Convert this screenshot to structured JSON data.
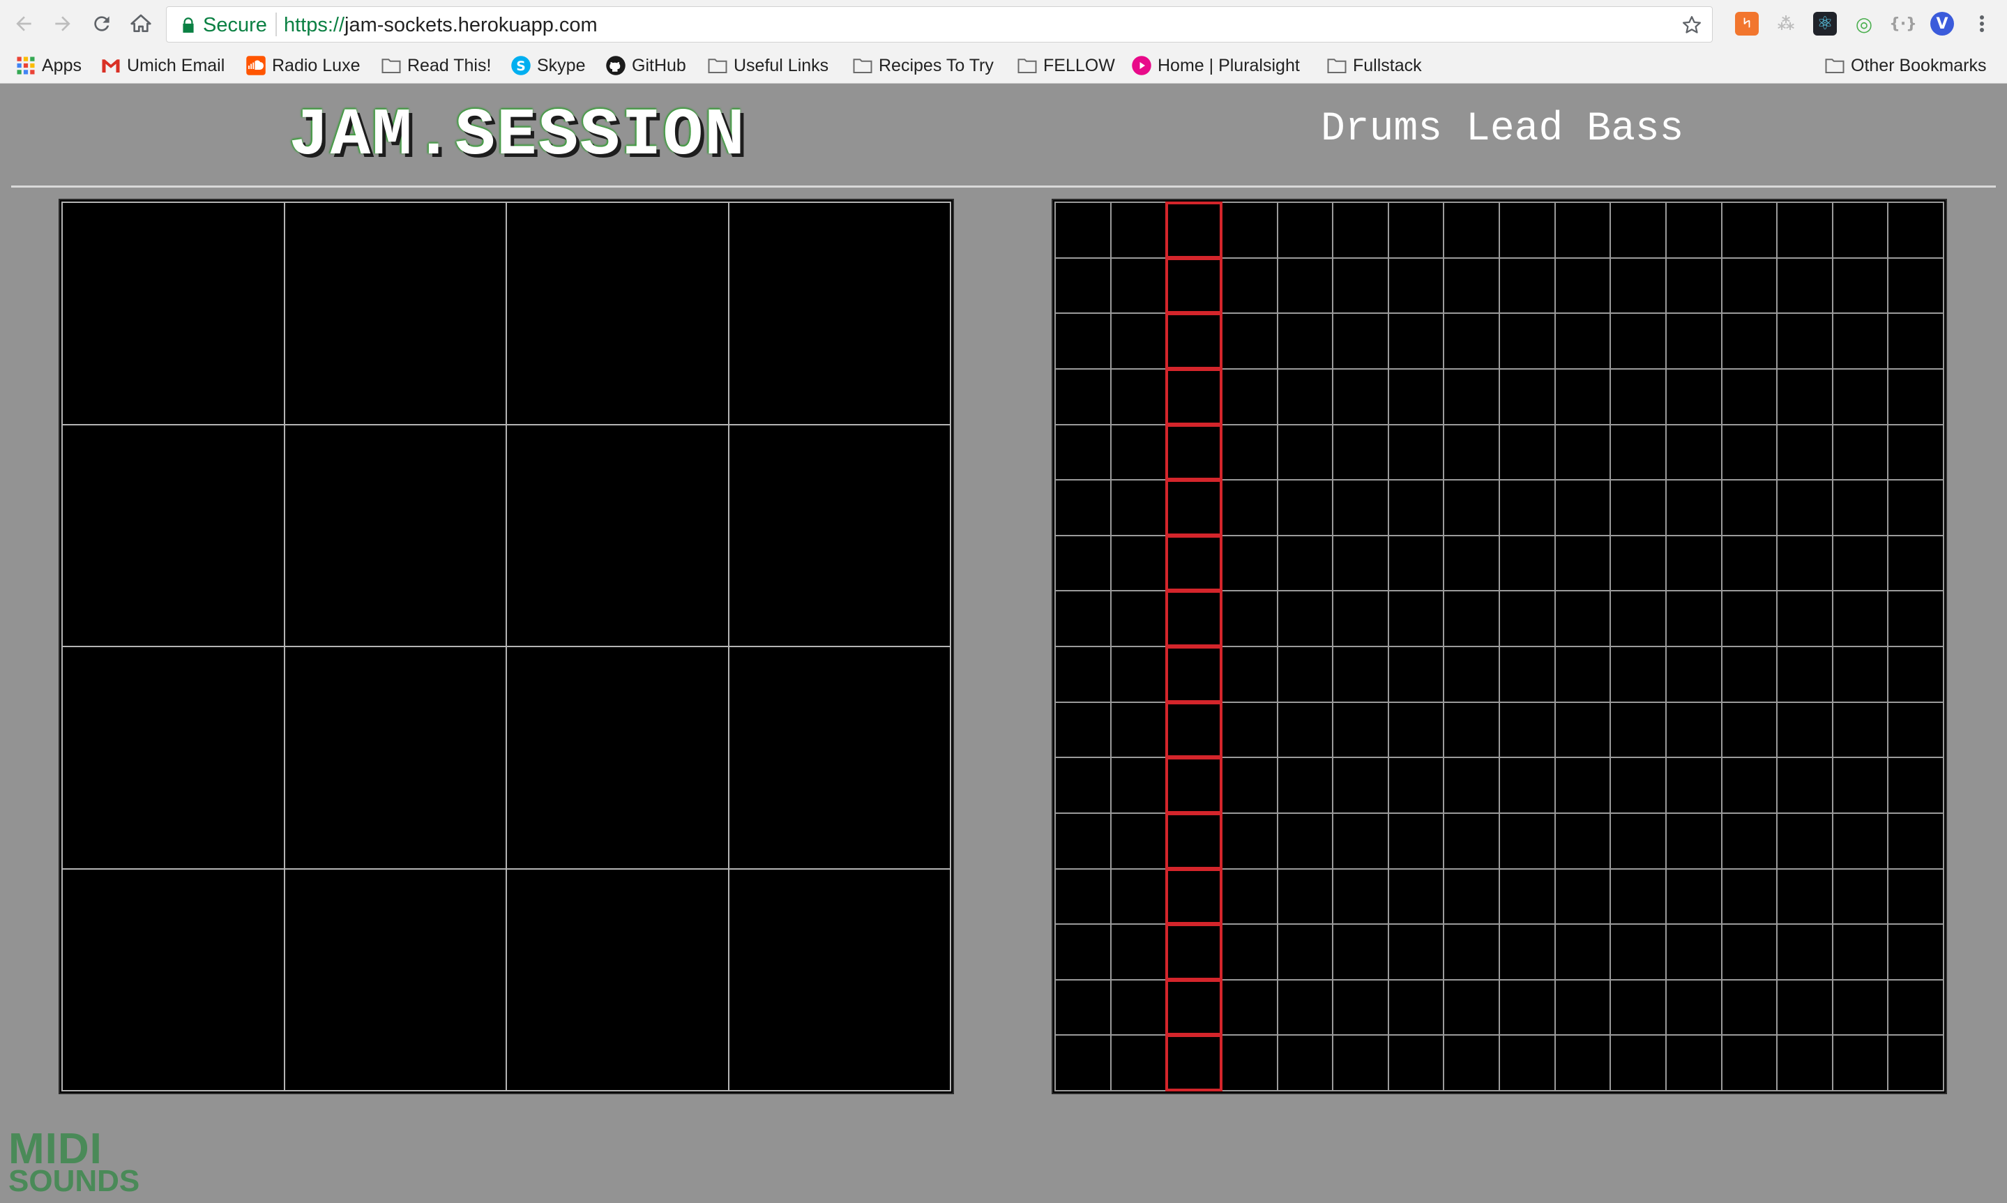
{
  "browser": {
    "secure_label": "Secure",
    "url_protocol": "https://",
    "url_host": "jam-sockets.herokuapp.com",
    "bookmarks": [
      {
        "label": "Apps",
        "icon": "apps-grid-icon"
      },
      {
        "label": "Umich Email",
        "icon": "gmail-icon"
      },
      {
        "label": "Radio Luxe",
        "icon": "soundcloud-icon"
      },
      {
        "label": "Read This!",
        "icon": "folder-icon"
      },
      {
        "label": "Skype",
        "icon": "skype-icon"
      },
      {
        "label": "GitHub",
        "icon": "github-icon"
      },
      {
        "label": "Useful Links",
        "icon": "folder-icon"
      },
      {
        "label": "Recipes To Try",
        "icon": "folder-icon"
      },
      {
        "label": "FELLOW",
        "icon": "folder-icon"
      },
      {
        "label": "Home | Pluralsight",
        "icon": "pluralsight-icon"
      },
      {
        "label": "Fullstack",
        "icon": "folder-icon"
      }
    ],
    "other_bookmarks": "Other Bookmarks"
  },
  "app": {
    "logo": "JAM.SESSION",
    "instruments": [
      "Drums",
      "Lead",
      "Bass"
    ],
    "pad_grid": {
      "rows": 4,
      "cols": 4
    },
    "sequencer": {
      "rows": 16,
      "cols": 16,
      "active_column": 3
    },
    "footer_logo_line1": "MIDI",
    "footer_logo_line2": "SOUNDS"
  },
  "colors": {
    "page_bg": "#939393",
    "grid_bg": "#000000",
    "grid_line": "#b5b5b5",
    "active_step": "#d4252b",
    "secure_green": "#0b8043"
  }
}
